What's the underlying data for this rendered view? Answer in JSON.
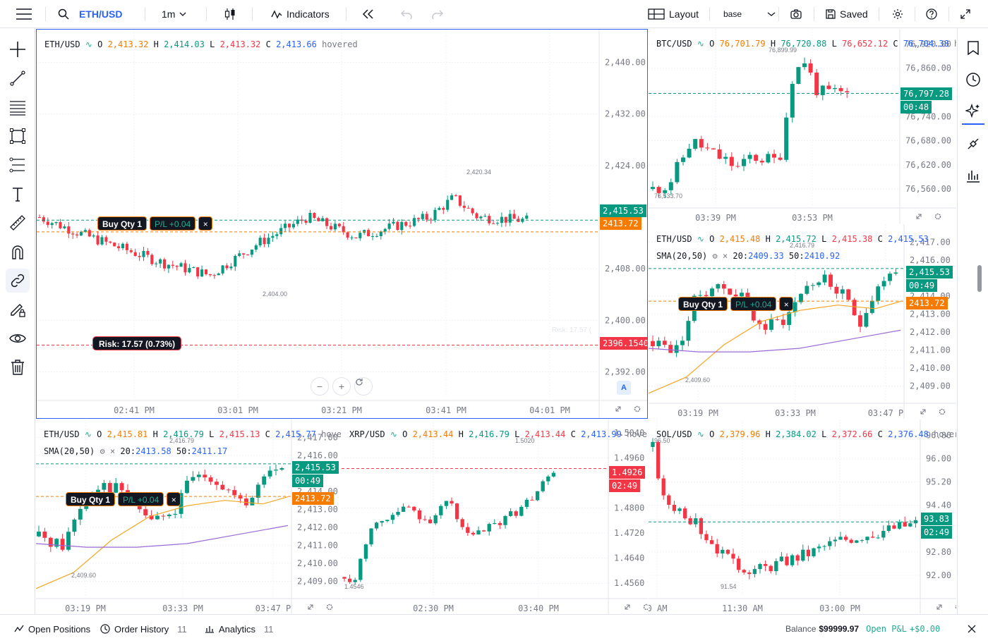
{
  "topbar": {
    "symbol": "ETH/USD",
    "interval": "1m",
    "indicators_label": "Indicators",
    "layout_label": "Layout",
    "layout_name": "base",
    "saved_label": "Saved"
  },
  "colors": {
    "up": "#089981",
    "down": "#f23645",
    "accent": "#2962ff",
    "order": "#f57c00",
    "sma_fast": "#f5a623",
    "sma_slow": "#9c6ad6"
  },
  "main": {
    "header": {
      "symbol": "ETH/USD",
      "o_label": "O",
      "o": "2,413.32",
      "h_label": "H",
      "h": "2,414.03",
      "l_label": "L",
      "l": "2,413.32",
      "c_label": "C",
      "c": "2,413.66",
      "hovered": "hovered"
    },
    "price_ticks": [
      "2,440.00",
      "2,432.00",
      "2,424.00",
      "2,408.00",
      "2,400.00",
      "2,392.00"
    ],
    "time_ticks": [
      "02:41 PM",
      "03:01 PM",
      "03:21 PM",
      "03:41 PM",
      "04:01 PM"
    ],
    "last_price": "2,415.53",
    "order_price": "2413.72",
    "risk_price": "2396.1540",
    "order_label": "Buy Qty 1",
    "pl_label": "P/L +0.04",
    "close_x": "×",
    "risk_label": "Risk: 17.57 (0.73%)",
    "risk_ghost": "Risk: 17.57 (",
    "high_annot": "2,420.34",
    "low_annot": "2,404.00",
    "auto_label": "A",
    "zoom_out": "−",
    "zoom_in": "+",
    "chart_data": {
      "type": "candlestick",
      "ylim": [
        2388,
        2444
      ],
      "visible_range": [
        "02:35 PM",
        "04:03 PM"
      ],
      "high": 2420.34,
      "low": 2404.0,
      "last": 2415.53,
      "order_level": 2413.72,
      "risk_level": 2396.154
    }
  },
  "btc": {
    "header": {
      "symbol": "BTC/USD",
      "o_label": "O",
      "o": "76,701.79",
      "h_label": "H",
      "h": "76,720.88",
      "l_label": "L",
      "l": "76,652.12",
      "c_label": "C",
      "c": "76,704.38",
      "hovered": "ho"
    },
    "price_ticks": [
      "76,920.00",
      "76,860.00",
      "76,740.00",
      "76,680.00",
      "76,620.00",
      "76,560.00"
    ],
    "time_ticks": [
      "03:39 PM",
      "03:53 PM"
    ],
    "last_price": "76,797.28",
    "countdown": "00:48",
    "high_annot": "76,899.99",
    "low_annot": "76,533.70",
    "chart_data": {
      "type": "candlestick",
      "ylim": [
        76520,
        76940
      ],
      "high": 76899.99,
      "low": 76533.7,
      "last": 76797.28
    }
  },
  "eth2": {
    "header": {
      "symbol": "ETH/USD",
      "o_label": "O",
      "o": "2,415.48",
      "h_label": "H",
      "h": "2,415.72",
      "l_label": "L",
      "l": "2,415.38",
      "c_label": "C",
      "c": "2,415.53"
    },
    "sma": {
      "label": "SMA(20,50)",
      "v20_label": "20:",
      "v20": "2409.33",
      "v50_label": "50:",
      "v50": "2410.92"
    },
    "price_ticks": [
      "2,417.00",
      "2,416.00",
      "2,414.00",
      "2,413.00",
      "2,412.00",
      "2,411.00",
      "2,410.00",
      "2,409.00"
    ],
    "time_ticks": [
      "03:19 PM",
      "03:33 PM",
      "03:47 P"
    ],
    "last_price": "2,415.53",
    "countdown": "00:49",
    "order_price": "2413.72",
    "order_label": "Buy Qty 1",
    "pl_label": "P/L +0.04",
    "close_x": "×",
    "high_annot": "2,416.79",
    "low_annot": "2,409.60",
    "chart_data": {
      "type": "candlestick",
      "ylim": [
        2408.2,
        2417.6
      ],
      "high": 2416.79,
      "low": 2409.6,
      "last": 2415.53,
      "sma20": 2409.33,
      "sma50": 2410.92
    }
  },
  "eth3": {
    "header": {
      "symbol": "ETH/USD",
      "o_label": "O",
      "o": "2,415.81",
      "h_label": "H",
      "h": "2,416.79",
      "l_label": "L",
      "l": "2,415.13",
      "c_label": "C",
      "c": "2,415.77",
      "hovered": "hovere"
    },
    "sma": {
      "label": "SMA(20,50)",
      "v20_label": "20:",
      "v20": "2413.58",
      "v50_label": "50:",
      "v50": "2411.17"
    },
    "price_ticks": [
      "2,417.00",
      "2,416.00",
      "2,414.00",
      "2,413.00",
      "2,412.00",
      "2,411.00",
      "2,410.00",
      "2,409.00"
    ],
    "time_ticks": [
      "03:19 PM",
      "03:33 PM",
      "03:47 P"
    ],
    "last_price": "2,415.53",
    "countdown": "00:49",
    "order_price": "2413.72",
    "order_label": "Buy Qty 1",
    "pl_label": "P/L +0.04",
    "close_x": "×",
    "high_annot": "2,416.79",
    "low_annot": "2,409.60",
    "chart_data": {
      "type": "candlestick",
      "ylim": [
        2408.2,
        2417.6
      ],
      "high": 2416.79,
      "low": 2409.6,
      "last": 2415.53,
      "sma20": 2413.58,
      "sma50": 2411.17
    }
  },
  "xrp": {
    "header": {
      "symbol": "XRP/USD",
      "o_label": "O",
      "o": "2,413.44",
      "h_label": "H",
      "h": "2,416.79",
      "l_label": "L",
      "l": "2,413.44",
      "c_label": "C",
      "c": "2,413.99",
      "hovered": "hovere"
    },
    "price_ticks": [
      "1.5040",
      "1.4960",
      "1.4800",
      "1.4720",
      "1.4640",
      "1.4560"
    ],
    "time_ticks": [
      "02:30 PM",
      "03:40 PM"
    ],
    "last_price": "1.4926",
    "countdown": "02:49",
    "high_annot": "1.5020",
    "low_annot": "1.4546",
    "chart_data": {
      "type": "candlestick",
      "ylim": [
        1.452,
        1.506
      ],
      "high": 1.502,
      "low": 1.4546,
      "last": 1.4926
    }
  },
  "sol": {
    "header": {
      "symbol": "SOL/USD",
      "o_label": "O",
      "o": "2,379.96",
      "h_label": "H",
      "h": "2,384.02",
      "l_label": "L",
      "l": "2,372.66",
      "c_label": "C",
      "c": "2,376.48",
      "hovered": "hovere"
    },
    "price_ticks": [
      "96.80",
      "96.00",
      "95.20",
      "94.40",
      "92.80",
      "92.00"
    ],
    "time_ticks": [
      "0 AM",
      "11:30 AM",
      "03:00 PM"
    ],
    "last_price": "93.83",
    "countdown": "02:49",
    "high_annot": "96.50",
    "low_annot": "91.54",
    "chart_data": {
      "type": "candlestick",
      "ylim": [
        91.3,
        97.1
      ],
      "high": 96.5,
      "low": 91.54,
      "last": 93.83
    }
  },
  "bottombar": {
    "open_positions": "Open Positions",
    "order_history": "Order History",
    "order_history_count": "11",
    "analytics": "Analytics",
    "analytics_count": "11",
    "balance_label": "Balance",
    "balance": "$99999.97",
    "open_pl_label": "Open P&L",
    "open_pl": "+$0.00"
  }
}
